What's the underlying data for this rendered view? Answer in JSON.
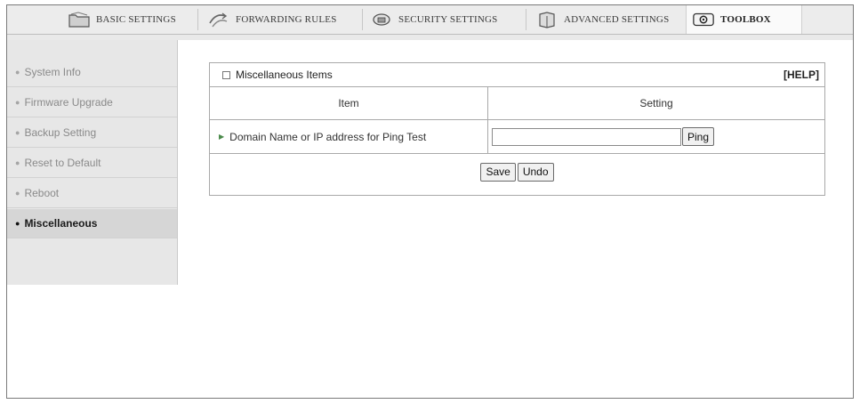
{
  "nav": {
    "tabs": [
      {
        "label": "BASIC SETTINGS",
        "icon": "folder-icon"
      },
      {
        "label": "FORWARDING RULES",
        "icon": "forward-arrows-icon"
      },
      {
        "label": "SECURITY SETTINGS",
        "icon": "shield-lock-icon"
      },
      {
        "label": "ADVANCED SETTINGS",
        "icon": "advanced-cube-icon"
      },
      {
        "label": "TOOLBOX",
        "icon": "toolbox-icon",
        "active": true
      }
    ]
  },
  "sidebar": {
    "items": [
      {
        "label": "System Info"
      },
      {
        "label": "Firmware Upgrade"
      },
      {
        "label": "Backup Setting"
      },
      {
        "label": "Reset to Default"
      },
      {
        "label": "Reboot"
      },
      {
        "label": "Miscellaneous",
        "active": true
      }
    ]
  },
  "panel": {
    "title": "Miscellaneous Items",
    "help": "[HELP]",
    "columns": {
      "item": "Item",
      "setting": "Setting"
    },
    "ping_row": {
      "label": "Domain Name or IP address for Ping Test",
      "value": "",
      "button": "Ping"
    },
    "actions": {
      "save": "Save",
      "undo": "Undo"
    }
  },
  "colors": {
    "nav_bg": "#ececec",
    "sidebar_bg": "#e7e7e7",
    "sidebar_active_bg": "#d6d6d6",
    "border": "#a9a9a9"
  }
}
